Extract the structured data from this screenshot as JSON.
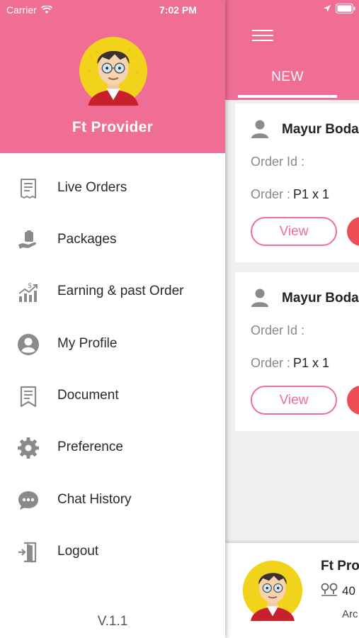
{
  "status_bar": {
    "carrier": "Carrier",
    "time": "7:02 PM"
  },
  "drawer": {
    "header_color": "#f06d96",
    "provider_name": "Ft Provider",
    "items": [
      {
        "label": "Live Orders",
        "icon": "receipt-icon"
      },
      {
        "label": "Packages",
        "icon": "package-hand-icon"
      },
      {
        "label": "Earning & past Order",
        "icon": "earnings-chart-icon"
      },
      {
        "label": "My Profile",
        "icon": "profile-icon"
      },
      {
        "label": "Document",
        "icon": "document-icon"
      },
      {
        "label": "Preference",
        "icon": "gear-icon"
      },
      {
        "label": "Chat History",
        "icon": "chat-icon"
      },
      {
        "label": "Logout",
        "icon": "logout-icon"
      }
    ],
    "version": "V.1.1"
  },
  "app": {
    "tab_label": "NEW",
    "orders": [
      {
        "name": "Mayur Boda",
        "order_id_label": "Order Id :",
        "order_label": "Order :",
        "order_value": "P1 x 1",
        "view_label": "View"
      },
      {
        "name": "Mayur Boda",
        "order_id_label": "Order Id :",
        "order_label": "Order :",
        "order_value": "P1 x 1",
        "view_label": "View"
      }
    ],
    "bottom": {
      "name": "Ft Pro",
      "distance": "40",
      "area": "Arc"
    },
    "accent_color": "#f06d96",
    "reject_color": "#ef4d55"
  }
}
